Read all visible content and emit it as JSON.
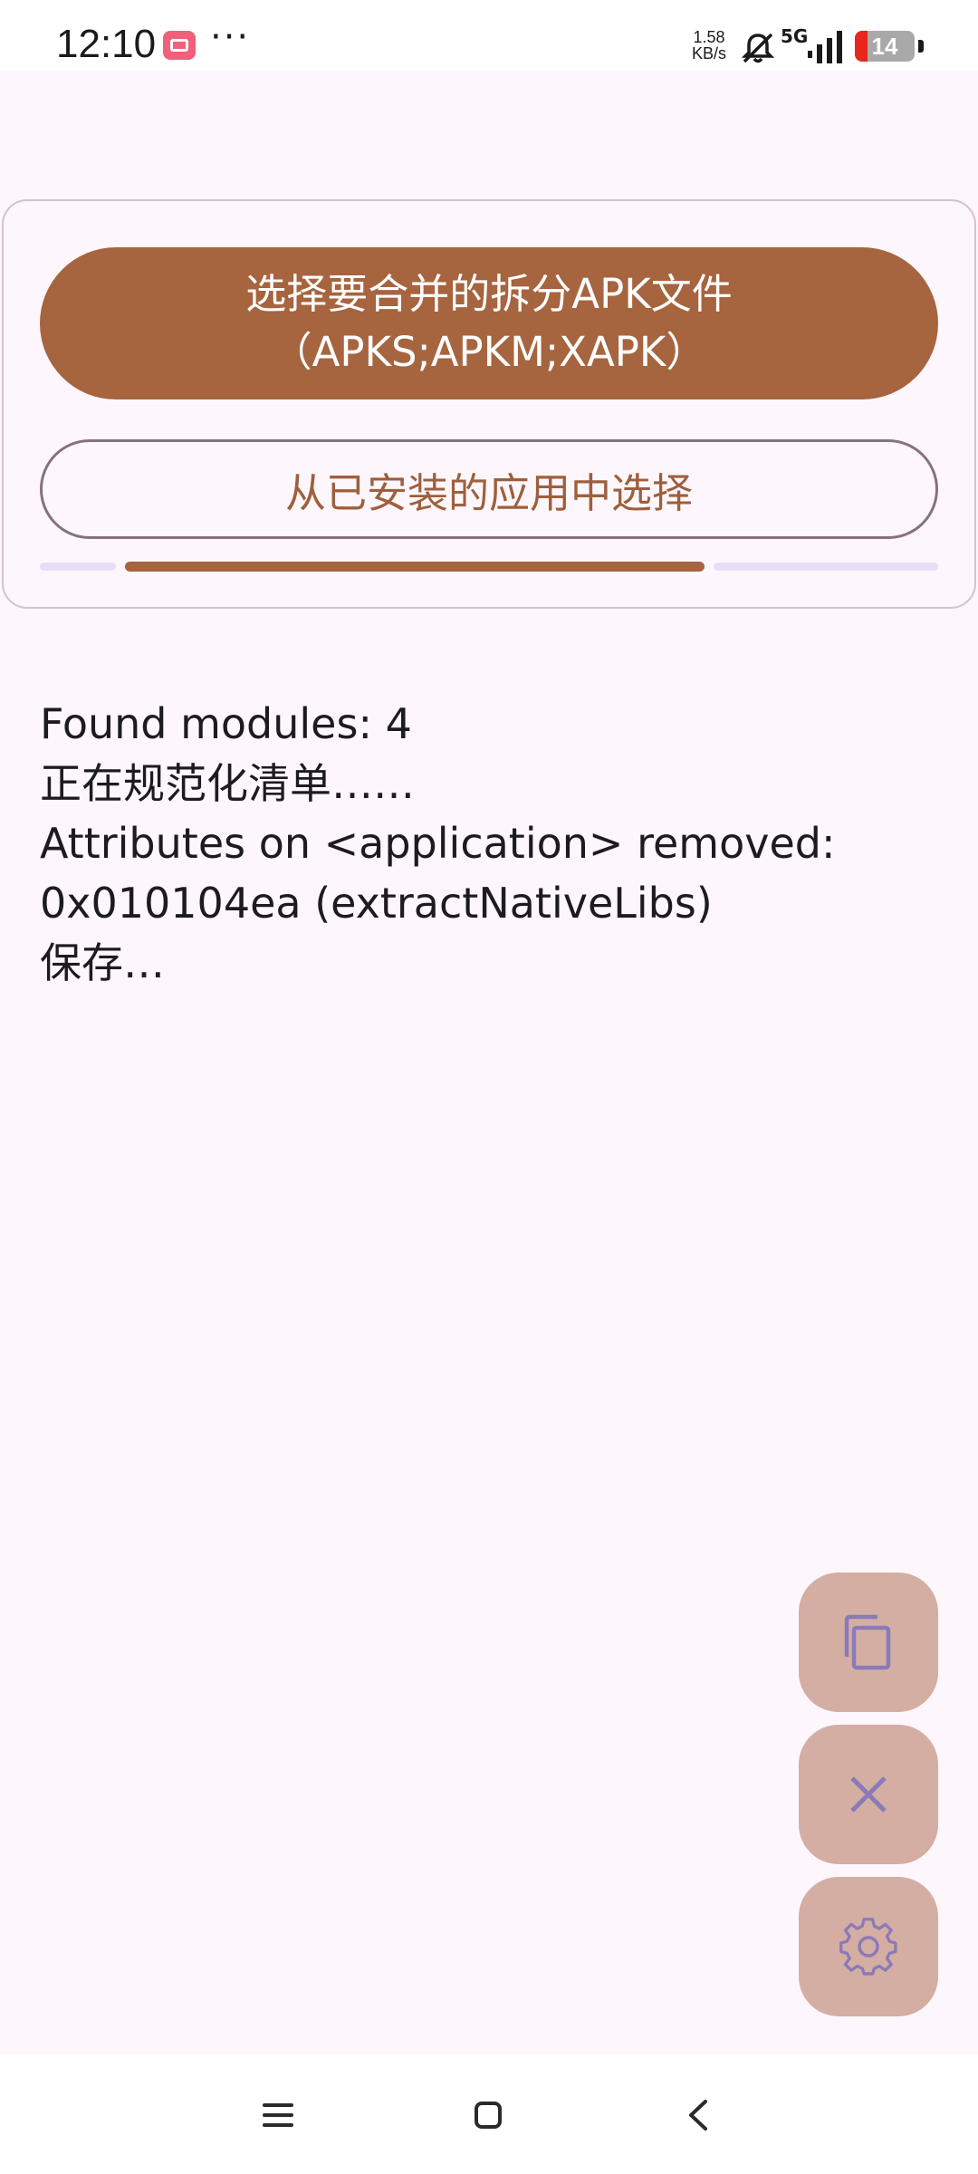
{
  "status_bar": {
    "time": "12:10",
    "more": "···",
    "net_speed_value": "1.58",
    "net_speed_unit": "KB/s",
    "network": "5G",
    "battery": "14"
  },
  "card": {
    "primary_button_line1": "选择要合并的拆分APK文件",
    "primary_button_line2": "（APKS;APKM;XAPK）",
    "secondary_button": "从已安装的应用中选择",
    "progress": 0.62
  },
  "log": {
    "lines": [
      "Found modules: 4",
      "正在规范化清单……",
      "Attributes on <application> removed:",
      "0x010104ea (extractNativeLibs)",
      "保存…"
    ]
  },
  "fabs": {
    "copy_icon": "copy-icon",
    "close_icon": "close-icon",
    "settings_icon": "gear-icon"
  },
  "nav_bar": {
    "menu_icon": "menu-icon",
    "home_icon": "home-icon",
    "back_icon": "back-icon"
  },
  "colors": {
    "primary": "#a6643f",
    "fab": "#d4aea3",
    "fab_icon": "#8a7ab8",
    "background": "#fdf7fd"
  }
}
